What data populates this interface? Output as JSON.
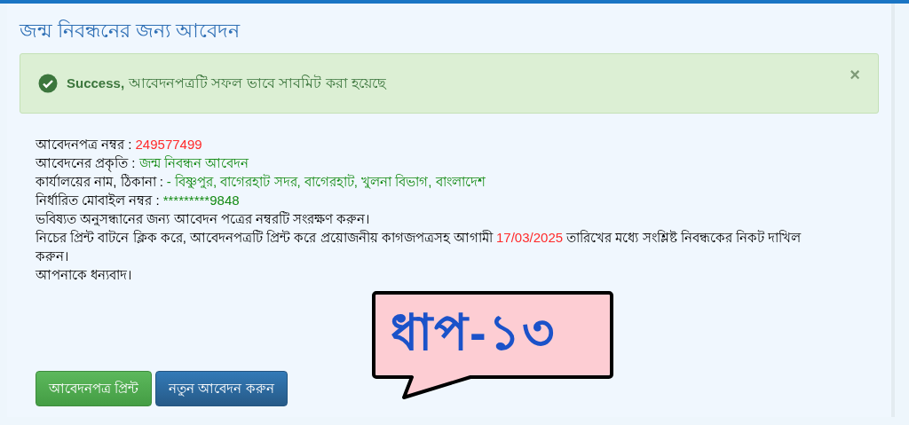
{
  "title": "জন্ম নিবন্ধনের জন্য আবেদন",
  "alert": {
    "label": "Success,",
    "message": "আবেদনপত্রটি সফল ভাবে সাবমিট করা হয়েছে",
    "close": "×"
  },
  "details": [
    {
      "label": "আবেদনপত্র নম্বর :",
      "value": "249577499",
      "color": "#ff2a2a"
    },
    {
      "label": "আবেদনের প্রকৃতি :",
      "value": "জন্ম নিবন্ধন আবেদন",
      "color": "#138a13"
    },
    {
      "label": "কার্যালয়ের নাম, ঠিকানা :",
      "value": "- বিষ্ণুপুর, বাগেরহাট সদর, বাগেরহাট, খুলনা বিভাগ, বাংলাদেশ",
      "color": "#138a13"
    },
    {
      "label": "নির্ধারিত মোবাইল নম্বর :",
      "value": "*********9848",
      "color": "#138a13"
    }
  ],
  "note": "ভবিষ্যত অনুসন্ধানের জন্য আবেদন পত্রের নম্বরটি সংরক্ষণ করুন।",
  "instruction": {
    "before": "নিচের প্রিন্ট বাটনে ক্লিক করে, আবেদনপত্রটি প্রিন্ট করে প্রয়োজনীয় কাগজপত্রসহ আগামী",
    "date": "17/03/2025",
    "after": "তারিখের মধ্যে সংশ্লিষ্ট নিবন্ধকের নিকট দাখিল করুন।"
  },
  "thanks": "আপনাকে ধন্যবাদ।",
  "buttons": [
    {
      "label": "আবেদনপত্র প্রিন্ট",
      "kind": "success"
    },
    {
      "label": "নতুন আবেদন করুন",
      "kind": "primary"
    }
  ],
  "callout": "ধাপ-১৩"
}
